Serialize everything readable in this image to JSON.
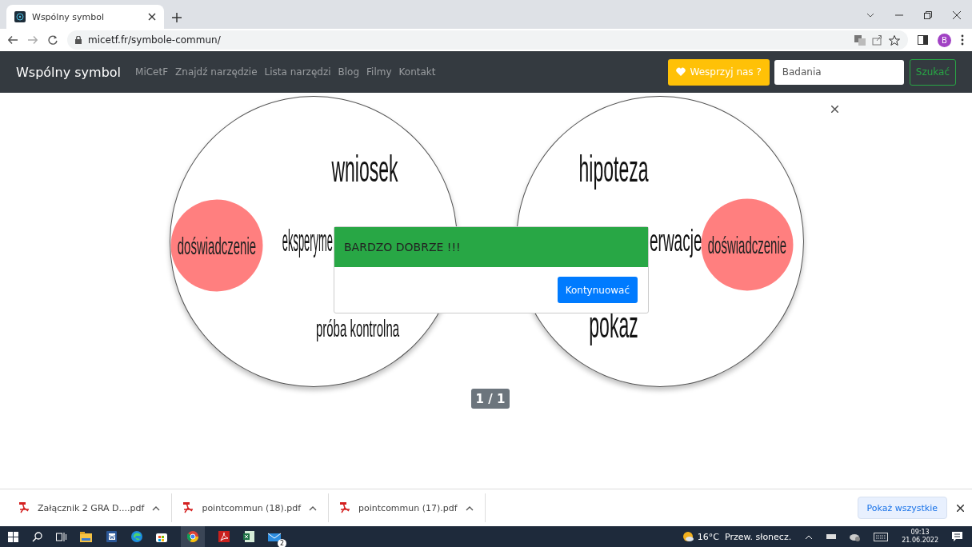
{
  "browser": {
    "tab_title": "Wspólny symbol",
    "url": "micetf.fr/symbole-commun/",
    "profile_initial": "B"
  },
  "navbar": {
    "brand": "Wspólny symbol",
    "links": [
      "MiCetF",
      "Znajdź narzędzie",
      "Lista narzędzi",
      "Blog",
      "Filmy",
      "Kontakt"
    ],
    "support_button": "Wesprzyj nas ?",
    "search": {
      "value": "Badania"
    },
    "search_button": "Szukać"
  },
  "game": {
    "circles": [
      {
        "items": [
          {
            "kind": "highlight",
            "text": "doświadczenie"
          },
          {
            "kind": "word",
            "text": "wniosek"
          },
          {
            "kind": "word",
            "text": "eksperyme"
          },
          {
            "kind": "word",
            "text": "próba kontrolna"
          }
        ]
      },
      {
        "items": [
          {
            "kind": "word",
            "text": "hipoteza"
          },
          {
            "kind": "word",
            "text": "erwacje"
          },
          {
            "kind": "word",
            "text": "pokaz"
          },
          {
            "kind": "highlight",
            "text": "doświadczenie"
          }
        ]
      }
    ],
    "page_counter": "1 / 1"
  },
  "dialog": {
    "message": "BARDZO DOBRZE !!!",
    "button": "Kontynuować"
  },
  "downloads": {
    "files": [
      "Załącznik 2 GRA D....pdf",
      "pointcommun (18).pdf",
      "pointcommun (17).pdf"
    ],
    "show_all": "Pokaż wszystkie"
  },
  "taskbar": {
    "temperature": "16°C",
    "weather_text": "Przew. słonecz.",
    "time": "09:13",
    "date": "21.06.2022",
    "mail_badge": "2"
  }
}
